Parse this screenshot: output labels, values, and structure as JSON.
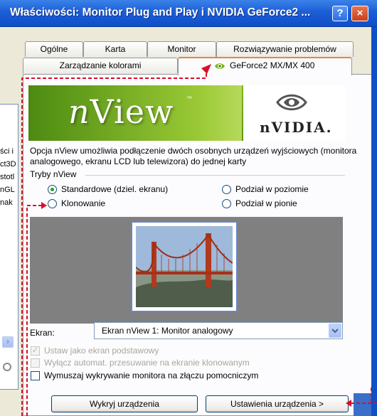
{
  "window": {
    "title": "Właściwości: Monitor Plug and Play i NVIDIA GeForce2 ...",
    "help_label": "?",
    "close_label": "×"
  },
  "tabs": {
    "row1": [
      "Ogólne",
      "Karta",
      "Monitor",
      "Rozwiązywanie problemów"
    ],
    "row2": [
      "Zarządzanie kolorami"
    ],
    "active": "GeForce2 MX/MX 400"
  },
  "banner": {
    "nview_prefix": "n",
    "nview_rest": "View",
    "tm": "™",
    "brand": "nVIDIA."
  },
  "description": "Opcja nView umożliwia podłączenie dwóch osobnych urządzeń wyjściowych (monitora analogowego, ekranu LCD lub telewizora) do jednej karty",
  "modes": {
    "legend": "Tryby nView",
    "options": [
      {
        "label": "Standardowe (dziel. ekranu)",
        "checked": true
      },
      {
        "label": "Klonowanie",
        "checked": false
      },
      {
        "label": "Podział w poziomie",
        "checked": false
      },
      {
        "label": "Podział w pionie",
        "checked": false
      }
    ]
  },
  "screen": {
    "label": "Ekran:",
    "selected": "Ekran nView 1: Monitor analogowy"
  },
  "checkboxes": [
    {
      "label": "Ustaw jako ekran podstawowy",
      "checked": true,
      "disabled": true
    },
    {
      "label": "Wyłącz automat. przesuwanie na ekranie klonowanym",
      "checked": false,
      "disabled": true
    },
    {
      "label": "Wymuszaj wykrywanie monitora na złączu pomocniczym",
      "checked": false,
      "disabled": false
    }
  ],
  "buttons": {
    "detect": "Wykryj urządzenia",
    "settings": "Ustawienia urządzenia >"
  },
  "background_window": {
    "fragments": [
      "ści i",
      "ct3D",
      "stotl",
      "nGL",
      "nak"
    ]
  },
  "colors": {
    "titlebar": "#1c5ed6",
    "active_tab_accent": "#e68b2c",
    "annotation_arrow": "#d8102a",
    "nvidia_green": "#76b900",
    "close_red": "#c6401a"
  }
}
